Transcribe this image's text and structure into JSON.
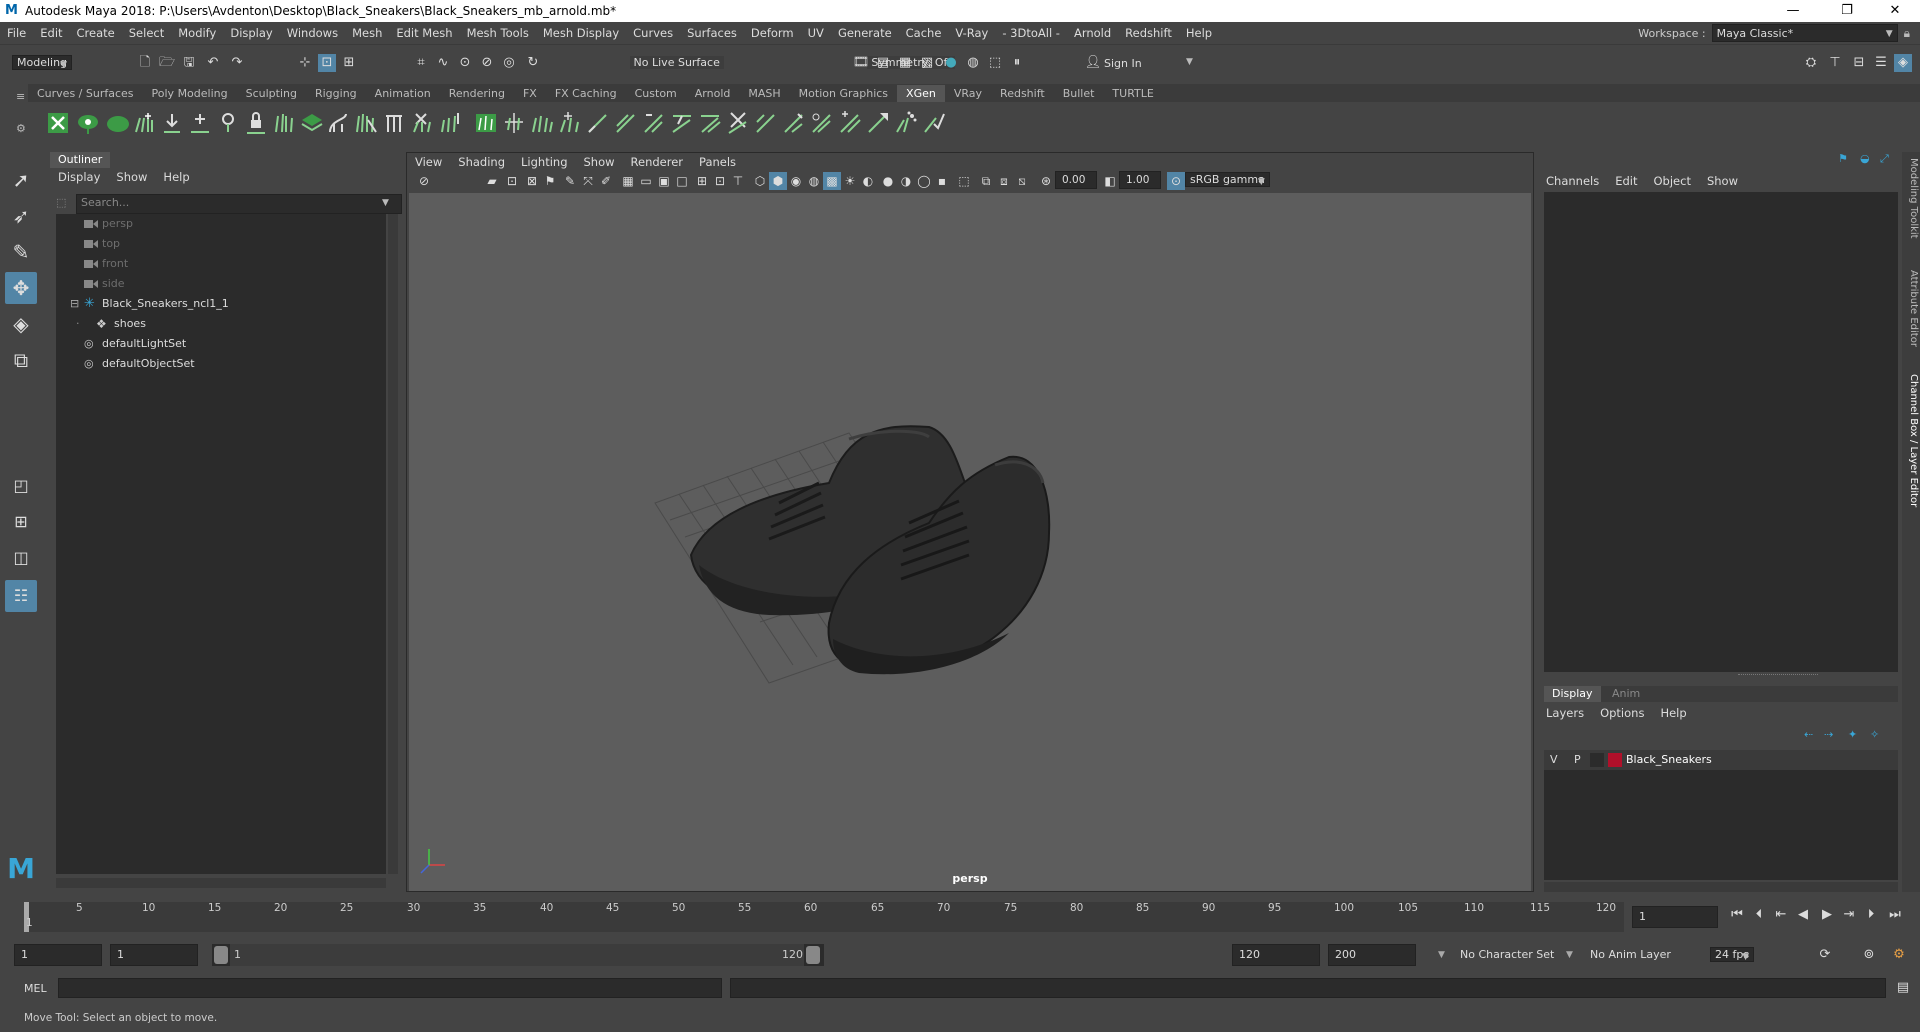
{
  "window": {
    "title": "Autodesk Maya 2018: P:\\Users\\Avdenton\\Desktop\\Black_Sneakers\\Black_Sneakers_mb_arnold.mb*",
    "minimize": "—",
    "maximize": "❐",
    "close": "✕"
  },
  "menubar": {
    "items": [
      "File",
      "Edit",
      "Create",
      "Select",
      "Modify",
      "Display",
      "Windows",
      "Mesh",
      "Edit Mesh",
      "Mesh Tools",
      "Mesh Display",
      "Curves",
      "Surfaces",
      "Deform",
      "UV",
      "Generate",
      "Cache",
      "V-Ray",
      "- 3DtoAll -",
      "Arnold",
      "Redshift",
      "Help"
    ],
    "workspace_label": "Workspace :",
    "workspace_value": "Maya Classic*"
  },
  "statusline": {
    "mode": "Modeling",
    "live_surface": "No Live Surface",
    "symmetry": "Symmetry: Off",
    "sign_in": "Sign In"
  },
  "shelf": {
    "tabs": [
      "Curves / Surfaces",
      "Poly Modeling",
      "Sculpting",
      "Rigging",
      "Animation",
      "Rendering",
      "FX",
      "FX Caching",
      "Custom",
      "Arnold",
      "MASH",
      "Motion Graphics",
      "XGen",
      "VRay",
      "Redshift",
      "Bullet",
      "TURTLE"
    ],
    "active_tab": "XGen"
  },
  "outliner": {
    "tab": "Outliner",
    "menu": [
      "Display",
      "Show",
      "Help"
    ],
    "search_placeholder": "Search...",
    "items": [
      {
        "label": "persp",
        "icon": "camera-icon",
        "dim": true
      },
      {
        "label": "top",
        "icon": "camera-icon",
        "dim": true
      },
      {
        "label": "front",
        "icon": "camera-icon",
        "dim": true
      },
      {
        "label": "side",
        "icon": "camera-icon",
        "dim": true
      },
      {
        "label": "Black_Sneakers_ncl1_1",
        "icon": "group-icon",
        "dim": false
      },
      {
        "label": "shoes",
        "icon": "mesh-icon",
        "dim": false
      },
      {
        "label": "defaultLightSet",
        "icon": "set-icon",
        "dim": false
      },
      {
        "label": "defaultObjectSet",
        "icon": "set-icon",
        "dim": false
      }
    ]
  },
  "viewport": {
    "menu": [
      "View",
      "Shading",
      "Lighting",
      "Show",
      "Renderer",
      "Panels"
    ],
    "exposure": "0.00",
    "gamma": "1.00",
    "color_space": "sRGB gamma",
    "camera_label": "persp"
  },
  "channelbox": {
    "menu": [
      "Channels",
      "Edit",
      "Object",
      "Show"
    ]
  },
  "layers": {
    "tabs": [
      "Display",
      "Anim"
    ],
    "menu": [
      "Layers",
      "Options",
      "Help"
    ],
    "layer": {
      "v": "V",
      "p": "P",
      "name": "Black_Sneakers",
      "color": "#b0102a"
    }
  },
  "sidetabs": [
    "Modeling Toolkit",
    "Attribute Editor",
    "Channel Box / Layer Editor"
  ],
  "timeline": {
    "labels": [
      "1",
      "5",
      "10",
      "15",
      "20",
      "25",
      "30",
      "35",
      "40",
      "45",
      "50",
      "55",
      "60",
      "65",
      "70",
      "75",
      "80",
      "85",
      "90",
      "95",
      "100",
      "105",
      "110",
      "115",
      "120"
    ],
    "current_frame": "1"
  },
  "range": {
    "start": "1",
    "anim_start": "1",
    "slider_start": "1",
    "slider_end": "120",
    "end": "120",
    "anim_end": "200",
    "character_set": "No Character Set",
    "anim_layer": "No Anim Layer",
    "fps": "24 fps"
  },
  "cmdline": {
    "label": "MEL"
  },
  "helpline": {
    "text": "Move Tool: Select an object to move."
  }
}
